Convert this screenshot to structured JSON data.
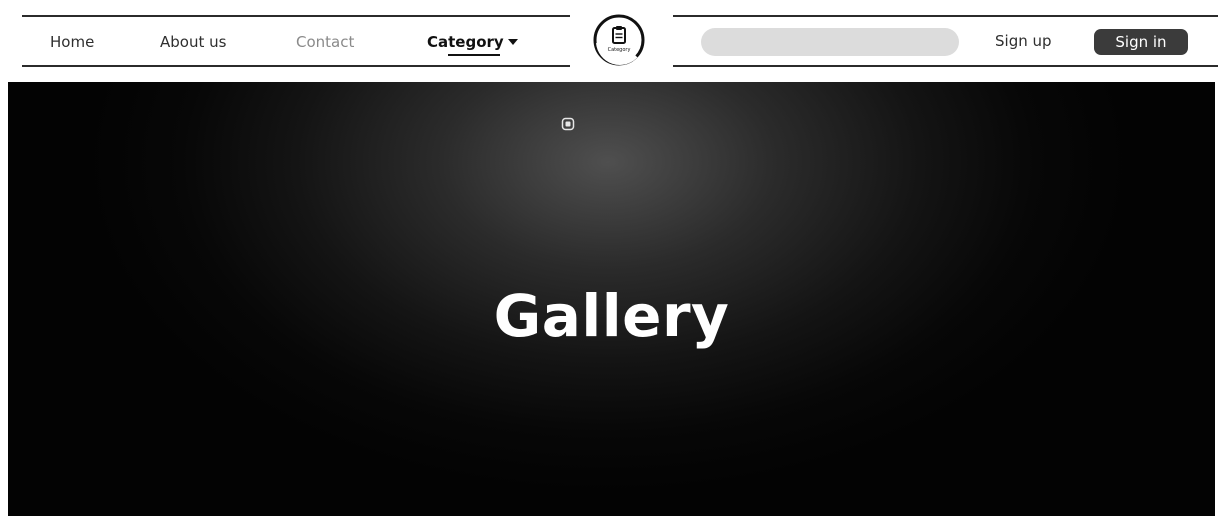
{
  "nav": {
    "home": "Home",
    "about": "About us",
    "contact": "Contact",
    "category": "Category"
  },
  "header": {
    "logo_text": "Category",
    "signup": "Sign up",
    "signin": "Sign in"
  },
  "search": {
    "value": "",
    "placeholder": ""
  },
  "hero": {
    "title": "Gallery"
  },
  "icons": {
    "logo": "clipboard-logo-icon",
    "dropdown": "caret-down-icon",
    "hero": "square-target-icon"
  },
  "colors": {
    "signin_bg": "#3b3b3b",
    "search_bg": "#dcdcdc",
    "hero_bg": "#050505",
    "text_dark": "#2f2f2f",
    "text_muted": "#8a8a8a"
  }
}
